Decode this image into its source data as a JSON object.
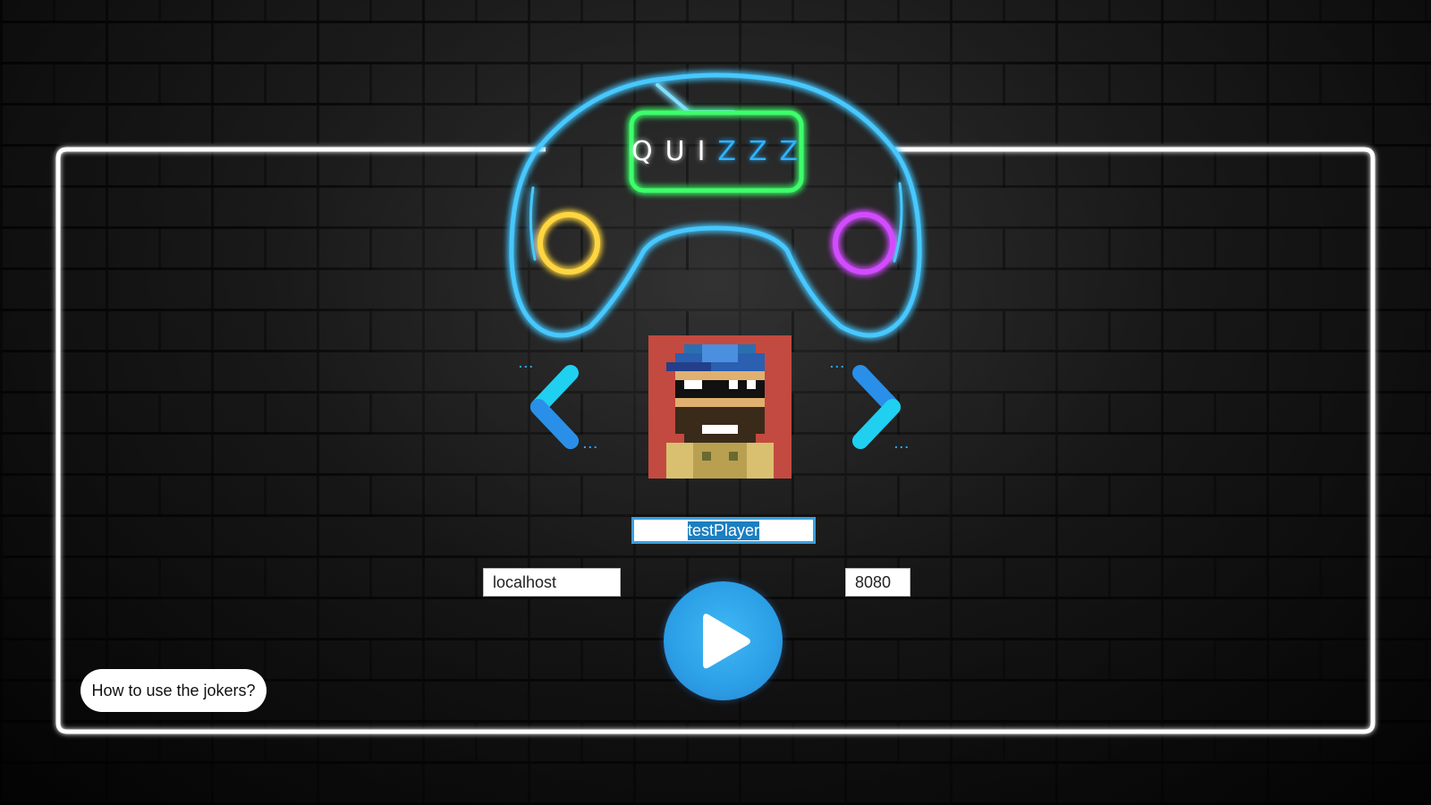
{
  "logo": {
    "text_white": "QUI",
    "text_blue": "ZZZ",
    "colors": {
      "controller_outline": "#46c8ff",
      "screen_outline": "#3cff6a",
      "left_ring": "#ffd640",
      "right_ring": "#d24bff",
      "frame": "#ffffff"
    }
  },
  "avatar_selector": {
    "prev_icon": "chevron-left-icon",
    "next_icon": "chevron-right-icon",
    "avatar_icon": "pixel-character-avatar",
    "accent_color": "#1fd0f0",
    "dots": "..."
  },
  "player": {
    "name_value": "testPlayer"
  },
  "server": {
    "host_value": "localhost",
    "port_value": "8080"
  },
  "play": {
    "icon": "play-icon",
    "color": "#2b9fe6"
  },
  "help": {
    "jokers_label": "How to use the jokers?"
  }
}
